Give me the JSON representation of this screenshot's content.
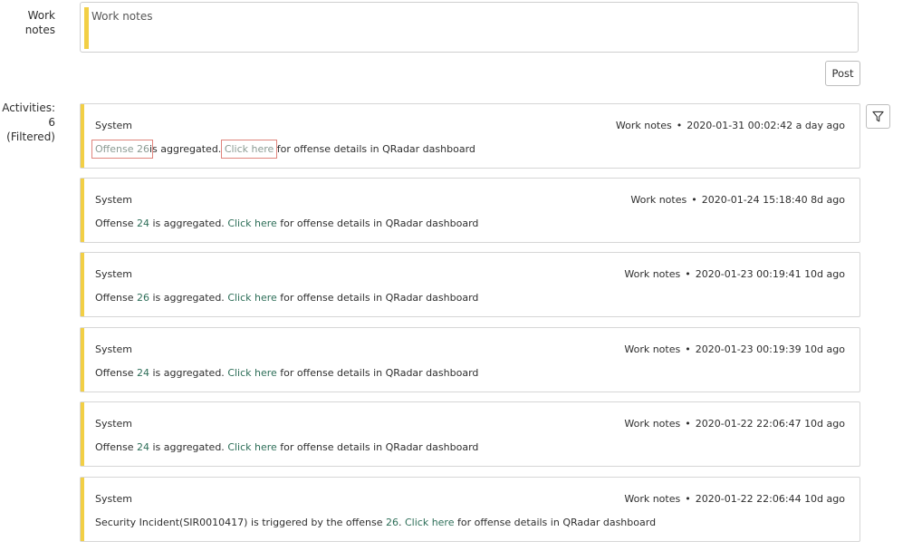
{
  "work_notes": {
    "label": "Work notes",
    "placeholder": "Work notes"
  },
  "post_label": "Post",
  "activities": {
    "label_line1": "Activities: 6",
    "label_line2": "(Filtered)",
    "items": [
      {
        "author": "System",
        "type": "Work notes",
        "timestamp": "2020-01-31 00:02:42",
        "relative": "a day ago",
        "pre": "Offense ",
        "offense": "26",
        "mid": "is aggregated. ",
        "link": "Click here",
        "post": " for offense details in QRadar dashboard"
      },
      {
        "author": "System",
        "type": "Work notes",
        "timestamp": "2020-01-24 15:18:40",
        "relative": "8d ago",
        "pre": "Offense ",
        "offense": "24",
        "mid": " is aggregated. ",
        "link": "Click here",
        "post": " for offense details in QRadar dashboard"
      },
      {
        "author": "System",
        "type": "Work notes",
        "timestamp": "2020-01-23 00:19:41",
        "relative": "10d ago",
        "pre": "Offense ",
        "offense": "26",
        "mid": " is aggregated. ",
        "link": "Click here",
        "post": " for offense details in QRadar dashboard"
      },
      {
        "author": "System",
        "type": "Work notes",
        "timestamp": "2020-01-23 00:19:39",
        "relative": "10d ago",
        "pre": "Offense ",
        "offense": "24",
        "mid": " is aggregated. ",
        "link": "Click here",
        "post": " for offense details in QRadar dashboard"
      },
      {
        "author": "System",
        "type": "Work notes",
        "timestamp": "2020-01-22 22:06:47",
        "relative": "10d ago",
        "pre": "Offense ",
        "offense": "24",
        "mid": " is aggregated. ",
        "link": "Click here",
        "post": " for offense details in QRadar dashboard"
      },
      {
        "author": "System",
        "type": "Work notes",
        "timestamp": "2020-01-22 22:06:44",
        "relative": "10d ago",
        "pre": "Security Incident(SIR0010417) is triggered by the offense ",
        "offense": "26",
        "mid": ". ",
        "link": "Click here",
        "post": " for offense details in QRadar dashboard"
      }
    ]
  },
  "meta_separator": "•",
  "icons": {
    "filter": "filter-icon"
  },
  "colors": {
    "accent_stripe": "#f2cf45",
    "link": "#2d6e58",
    "highlight_box": "#e0847c"
  }
}
